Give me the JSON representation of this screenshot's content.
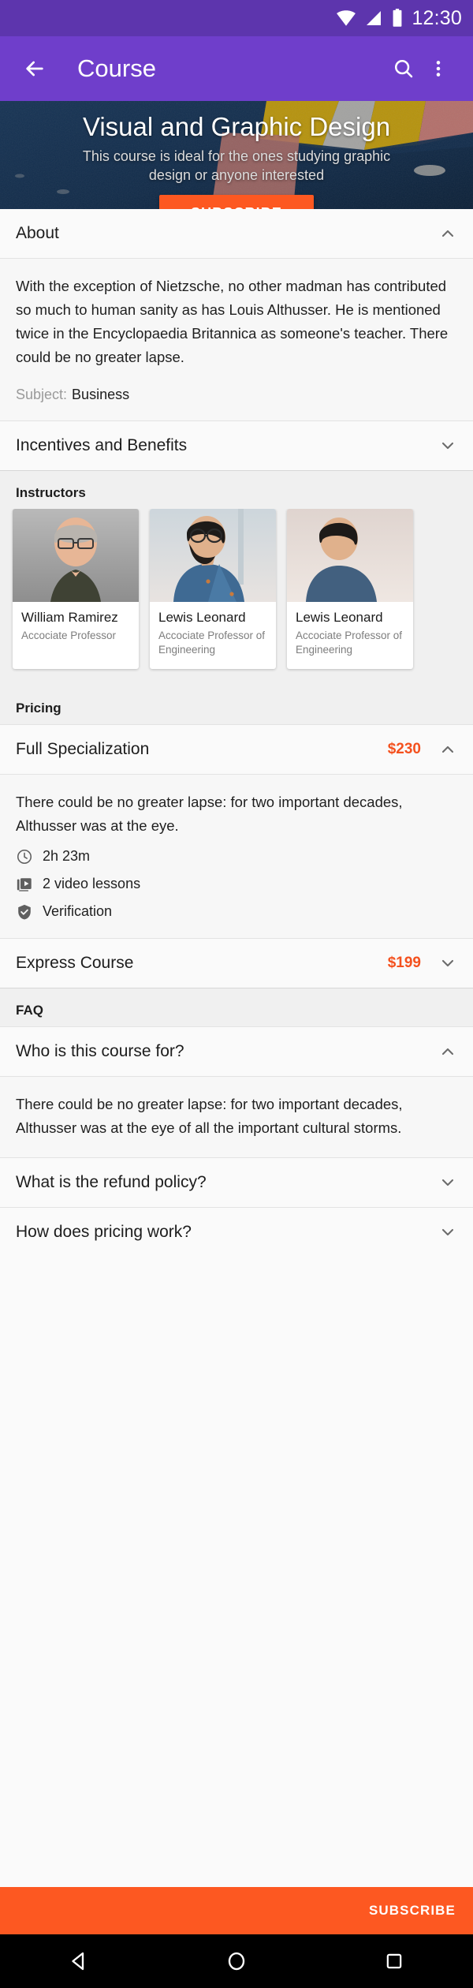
{
  "status_bar": {
    "time": "12:30",
    "icons": [
      "wifi-icon",
      "signal-icon",
      "battery-icon"
    ]
  },
  "app_bar": {
    "back_label": "back-arrow-icon",
    "title": "Course",
    "search_label": "search-icon",
    "overflow_label": "more-vert-icon"
  },
  "hero": {
    "title": "Visual and Graphic Design",
    "subtitle": "This course is ideal for the ones studying graphic design or anyone interested",
    "subscribe_label": "SUBSCRIBE"
  },
  "about": {
    "header": "About",
    "expanded": true,
    "body": "With the exception of Nietzsche, no other madman has contributed so much to human sanity as has Louis Althusser. He is mentioned twice in the Encyclopaedia Britannica as someone's teacher. There could be no greater lapse.",
    "subject_key": "Subject:",
    "subject_value": "Business"
  },
  "incentives": {
    "header": "Incentives and Benefits",
    "expanded": false
  },
  "instructors": {
    "header": "Instructors",
    "cards": [
      {
        "name": "William Ramirez",
        "role": "Accociate Professor"
      },
      {
        "name": "Lewis Leonard",
        "role": "Accociate Professor of Engineering"
      },
      {
        "name": "Lewis Leonard",
        "role": "Accociate Professor of Engineering"
      }
    ]
  },
  "pricing": {
    "header": "Pricing",
    "plans": [
      {
        "name": "Full Specialization",
        "price": "$230",
        "expanded": true,
        "body": "There could be no greater lapse: for two important decades, Althusser was at the eye.",
        "meta": [
          {
            "icon": "clock-icon",
            "text": "2h 23m"
          },
          {
            "icon": "video-library-icon",
            "text": "2 video lessons"
          },
          {
            "icon": "verified-shield-icon",
            "text": "Verification"
          }
        ]
      },
      {
        "name": "Express Course",
        "price": "$199",
        "expanded": false
      }
    ]
  },
  "faq": {
    "header": "FAQ",
    "items": [
      {
        "question": "Who is this course for?",
        "expanded": true,
        "answer": "There could be no greater lapse: for two important decades, Althusser was at the eye of all the important cultural storms."
      },
      {
        "question": "What is the refund policy?",
        "expanded": false
      },
      {
        "question": "How does pricing work?",
        "expanded": false
      }
    ]
  },
  "sticky_bar": {
    "subscribe_label": "SUBSCRIBE"
  },
  "nav_bar": {
    "back": "nav-back-icon",
    "home": "nav-home-icon",
    "recents": "nav-recents-icon"
  },
  "colors": {
    "status_bar": "#5d35ad",
    "app_bar": "#6f3ecb",
    "accent_orange": "#fd5821",
    "price_orange": "#f4511e"
  }
}
